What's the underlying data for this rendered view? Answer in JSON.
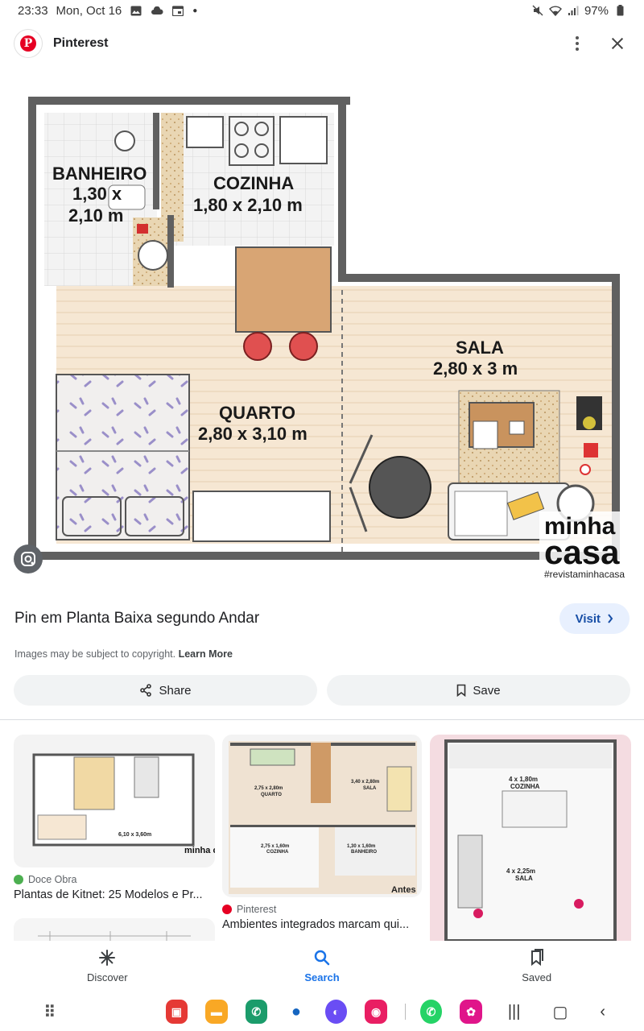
{
  "status": {
    "time": "23:33",
    "date": "Mon, Oct 16",
    "battery": "97%"
  },
  "header": {
    "site_name": "Pinterest"
  },
  "plan": {
    "rooms": [
      {
        "name": "BANHEIRO",
        "size_a": "1,30 x",
        "size_b": "2,10 m"
      },
      {
        "name": "COZINHA",
        "size": "1,80 x 2,10 m"
      },
      {
        "name": "SALA",
        "size": "2,80 x 3 m"
      },
      {
        "name": "QUARTO",
        "size": "2,80 x 3,10 m"
      }
    ],
    "brand_line1": "minha",
    "brand_line2": "casa",
    "brand_tag": "#revistaminhacasa"
  },
  "pin": {
    "title": "Pin em Planta Baixa segundo Andar",
    "visit_label": "Visit",
    "copyright_text": "Images may be subject to copyright.",
    "learn_more": "Learn More",
    "share_label": "Share",
    "save_label": "Save"
  },
  "related": [
    {
      "source": "Doce Obra",
      "title": "Plantas de Kitnet: 25 Modelos e Pr...",
      "thumb_label": "6,10 x 3,60m",
      "thumb_brand": "minha casa"
    },
    {
      "source": "Pinterest",
      "title": "Ambientes integrados marcam qui...",
      "labels": [
        "2,75 x 2,80m",
        "QUARTO",
        "3,40 x 2,80m",
        "SALA",
        "2,75 x 1,60m",
        "COZINHA",
        "1,30 x 1,60m",
        "BANHEIRO",
        "Antes"
      ]
    },
    {
      "labels": [
        "4 x 1,80m",
        "COZINHA",
        "4 x 2,25m",
        "SALA"
      ]
    }
  ],
  "bottom_nav": {
    "discover": "Discover",
    "search": "Search",
    "saved": "Saved"
  },
  "colors": {
    "accent": "#1a73e8",
    "visit_bg": "#e8f0fe",
    "pinterest_red": "#e60023"
  }
}
